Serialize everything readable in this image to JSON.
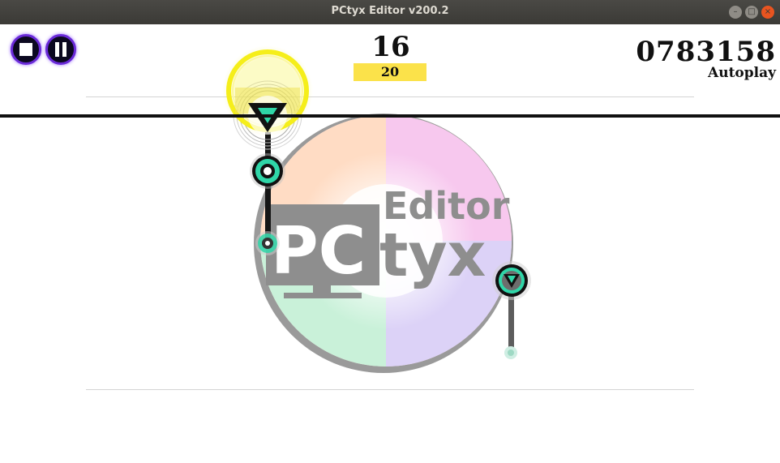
{
  "window": {
    "title": "PCtyx Editor v200.2",
    "buttons": {
      "minimize": "–",
      "maximize": "□",
      "close": "×"
    }
  },
  "hud": {
    "combo": "16",
    "max_combo": "20",
    "score": "0783158",
    "mode": "Autoplay"
  },
  "logo": {
    "word_top": "Editor",
    "word_left": "PC",
    "word_right": "tyx"
  },
  "colors": {
    "accent_purple": "#6a2ad8",
    "note_teal": "#2fd6a8",
    "highlight_yellow": "#f5ee1a",
    "combo_badge": "#fbe24a",
    "scanline": "#111111"
  }
}
